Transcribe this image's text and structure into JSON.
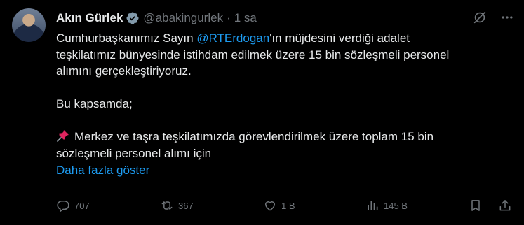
{
  "author": {
    "name": "Akın Gürlek",
    "handle": "@abakingurlek",
    "separator": "·",
    "time": "1 sa"
  },
  "tweet": {
    "line1_pre": "Cumhurbaşkanımız Sayın ",
    "mention": "@RTErdogan",
    "line1_post": "'ın müjdesini verdiği adalet",
    "line2": "teşkilatımız bünyesinde istihdam edilmek üzere 15 bin sözleşmeli personel",
    "line3": "alımını gerçekleştiriyoruz.",
    "line4": "Bu kapsamda;",
    "line5": "Merkez ve taşra teşkilatımızda görevlendirilmek üzere toplam 15 bin",
    "line6": "sözleşmeli personel alımı için",
    "show_more": "Daha fazla göster"
  },
  "actions": {
    "replies": "707",
    "reposts": "367",
    "likes": "1 B",
    "views": "145 B"
  },
  "colors": {
    "background": "#000000",
    "text": "#e7e9ea",
    "muted": "#71767b",
    "accent": "#1d9bf0"
  },
  "icons": [
    "verified-badge-icon",
    "grok-icon",
    "more-icon",
    "pin-icon",
    "reply-icon",
    "repost-icon",
    "like-icon",
    "views-icon",
    "bookmark-icon",
    "share-icon"
  ]
}
